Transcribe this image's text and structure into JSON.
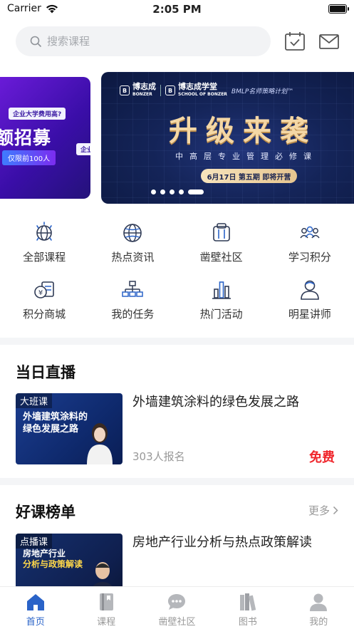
{
  "status_bar": {
    "carrier": "Carrier",
    "time": "2:05 PM"
  },
  "search": {
    "placeholder": "搜索课程"
  },
  "banner": {
    "left": {
      "tag": "企业大学费用高?",
      "headline": "额招募",
      "sub": "仅限前100人",
      "tag2": "企业"
    },
    "main": {
      "logo1": "博志成",
      "logo1_en": "BONZER",
      "logo2": "博志成学堂",
      "logo2_en": "SCHOOL OF BONZER",
      "plan": "BMLP名师策略计划™",
      "title": "升级来袭",
      "subtitle": "中高层专业管理必修课",
      "date": "6月17日 第五期 即将开营"
    },
    "dots": 5,
    "active_dot": 4
  },
  "quick_nav": [
    {
      "label": "全部课程",
      "icon": "globe-sparkle-icon"
    },
    {
      "label": "热点资讯",
      "icon": "globe-icon"
    },
    {
      "label": "凿壁社区",
      "icon": "community-icon"
    },
    {
      "label": "学习积分",
      "icon": "people-icon"
    },
    {
      "label": "积分商城",
      "icon": "coin-store-icon"
    },
    {
      "label": "我的任务",
      "icon": "org-chart-icon"
    },
    {
      "label": "热门活动",
      "icon": "bar-chart-icon"
    },
    {
      "label": "明星讲师",
      "icon": "teacher-icon"
    }
  ],
  "live_section": {
    "title": "当日直播",
    "course": {
      "thumb_tag": "大班课",
      "thumb_line1": "外墙建筑涂料的",
      "thumb_line2": "绿色发展之路",
      "title": "外墙建筑涂料的绿色发展之路",
      "enrolled": "303人报名",
      "price": "免费"
    }
  },
  "top_section": {
    "title": "好课榜单",
    "more": "更多",
    "course": {
      "thumb_tag": "点播课",
      "thumb_line1": "房地产行业",
      "thumb_line2": "分析与政策解读",
      "title": "房地产行业分析与热点政策解读"
    }
  },
  "tabs": [
    {
      "label": "首页",
      "icon": "home-icon",
      "active": true
    },
    {
      "label": "课程",
      "icon": "book-icon",
      "active": false
    },
    {
      "label": "凿壁社区",
      "icon": "chat-bubble-icon",
      "active": false
    },
    {
      "label": "图书",
      "icon": "books-icon",
      "active": false
    },
    {
      "label": "我的",
      "icon": "user-icon",
      "active": false
    }
  ],
  "colors": {
    "accent": "#2a63c8",
    "price": "#f0262c",
    "banner_bg": "#142458"
  }
}
